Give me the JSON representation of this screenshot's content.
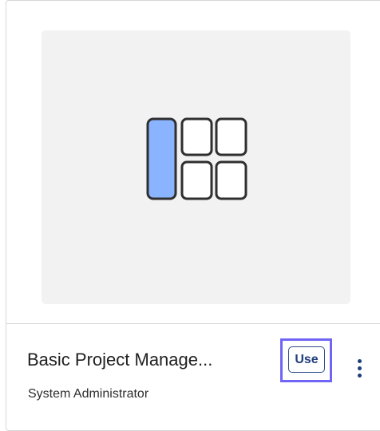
{
  "template_card": {
    "title": "Basic Project Manage...",
    "owner": "System Administrator",
    "use_label": "Use",
    "thumbnail_icon": "board-layout-icon",
    "more_icon": "kebab-menu-icon"
  },
  "colors": {
    "icon_fill": "#8ab4ff",
    "icon_stroke": "#2f2f2f",
    "focus_ring": "#7165f6",
    "button_text": "#203e7d",
    "thumbnail_bg": "#f2f2f2"
  }
}
